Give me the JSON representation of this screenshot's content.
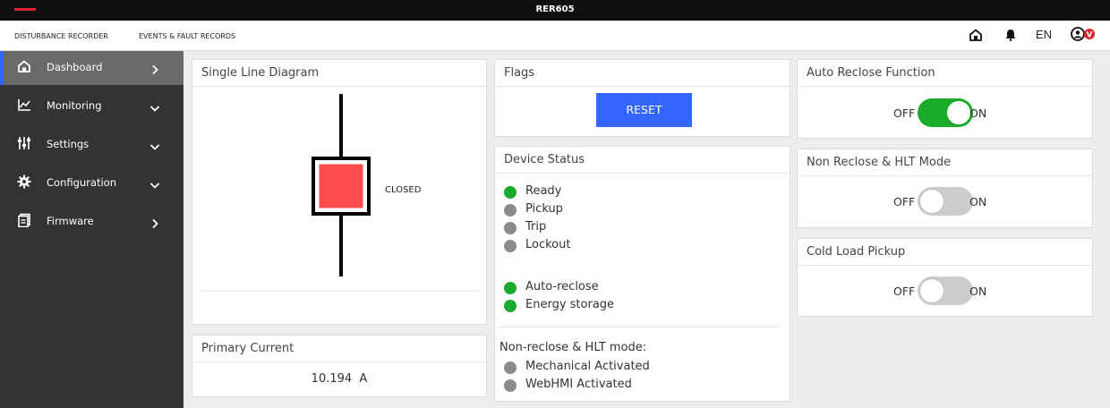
{
  "app": {
    "title": "RER605"
  },
  "header": {
    "links": [
      "DISTURBANCE RECORDER",
      "EVENTS & FAULT RECORDS"
    ],
    "lang": "EN",
    "user_badge": "V",
    "icons": [
      "home-icon",
      "bell-icon",
      "user-icon"
    ]
  },
  "sidebar": {
    "items": [
      {
        "label": "Dashboard",
        "icon": "home-icon",
        "chevron": "chevron-right-icon",
        "active": true
      },
      {
        "label": "Monitoring",
        "icon": "chart-icon",
        "chevron": "chevron-down-icon",
        "active": false
      },
      {
        "label": "Settings",
        "icon": "sliders-icon",
        "chevron": "chevron-down-icon",
        "active": false
      },
      {
        "label": "Configuration",
        "icon": "gear-icon",
        "chevron": "chevron-down-icon",
        "active": false
      },
      {
        "label": "Firmware",
        "icon": "document-icon",
        "chevron": "chevron-right-icon",
        "active": false
      }
    ]
  },
  "sld": {
    "title": "Single Line Diagram",
    "breaker_state": "CLOSED"
  },
  "primary_current": {
    "title": "Primary Current",
    "value": "10.194  A"
  },
  "flags": {
    "title": "Flags",
    "reset_label": "RESET"
  },
  "device_status": {
    "title": "Device Status",
    "group1": [
      {
        "label": "Ready",
        "active": true
      },
      {
        "label": "Pickup",
        "active": false
      },
      {
        "label": "Trip",
        "active": false
      },
      {
        "label": "Lockout",
        "active": false
      }
    ],
    "group2": [
      {
        "label": "Auto-reclose",
        "active": true
      },
      {
        "label": "Energy storage",
        "active": true
      }
    ],
    "hlt_title": "Non-reclose & HLT mode:",
    "group3": [
      {
        "label": "Mechanical Activated",
        "active": false
      },
      {
        "label": "WebHMI Activated",
        "active": false
      }
    ]
  },
  "toggles": {
    "auto_reclose": {
      "title": "Auto Reclose Function",
      "off": "OFF",
      "on": "ON",
      "state": true
    },
    "non_reclose": {
      "title": "Non Reclose & HLT Mode",
      "off": "OFF",
      "on": "ON",
      "state": false
    },
    "cold_load": {
      "title": "Cold Load Pickup",
      "off": "OFF",
      "on": "ON",
      "state": false
    }
  },
  "colors": {
    "accent": "#3366ff",
    "status_on": "#1aab2b",
    "status_off": "#8a8a8a",
    "toggle_on": "#1aab2b",
    "toggle_off": "#cccccc",
    "breaker_fill": "#ff4d4d",
    "brand": "#e0232e"
  }
}
